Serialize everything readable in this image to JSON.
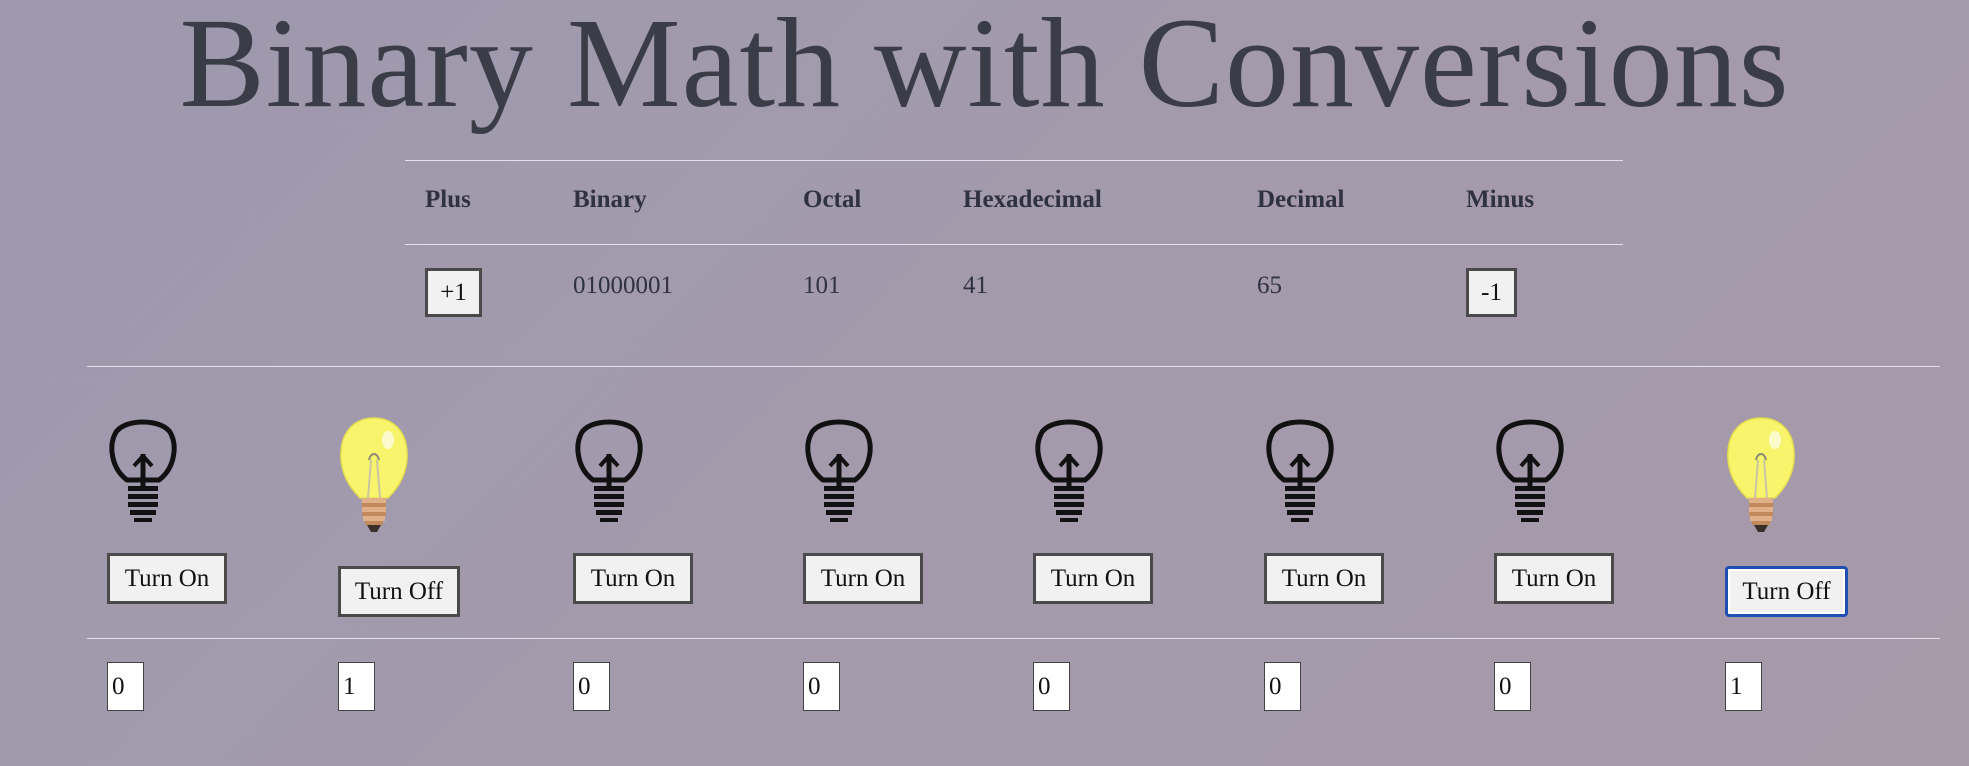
{
  "title": "Binary Math with Conversions",
  "table": {
    "headers": {
      "plus": "Plus",
      "binary": "Binary",
      "octal": "Octal",
      "hex": "Hexadecimal",
      "decimal": "Decimal",
      "minus": "Minus"
    },
    "row": {
      "plus_label": "+1",
      "binary": "01000001",
      "octal": "101",
      "hex": "41",
      "decimal": "65",
      "minus_label": "-1"
    }
  },
  "bits": [
    {
      "state": "off",
      "button": "Turn On",
      "value": "0"
    },
    {
      "state": "on",
      "button": "Turn Off",
      "value": "1"
    },
    {
      "state": "off",
      "button": "Turn On",
      "value": "0"
    },
    {
      "state": "off",
      "button": "Turn On",
      "value": "0"
    },
    {
      "state": "off",
      "button": "Turn On",
      "value": "0"
    },
    {
      "state": "off",
      "button": "Turn On",
      "value": "0"
    },
    {
      "state": "off",
      "button": "Turn On",
      "value": "0"
    },
    {
      "state": "on",
      "button": "Turn Off",
      "value": "1"
    }
  ],
  "colors": {
    "background": "#a09bad",
    "bulb_on": "#f7f36a",
    "bulb_off_stroke": "#111111",
    "focus_border": "#1f4fb0"
  },
  "icons": {
    "bulb_off": "lightbulb-outline-icon",
    "bulb_on": "lightbulb-lit-icon"
  }
}
